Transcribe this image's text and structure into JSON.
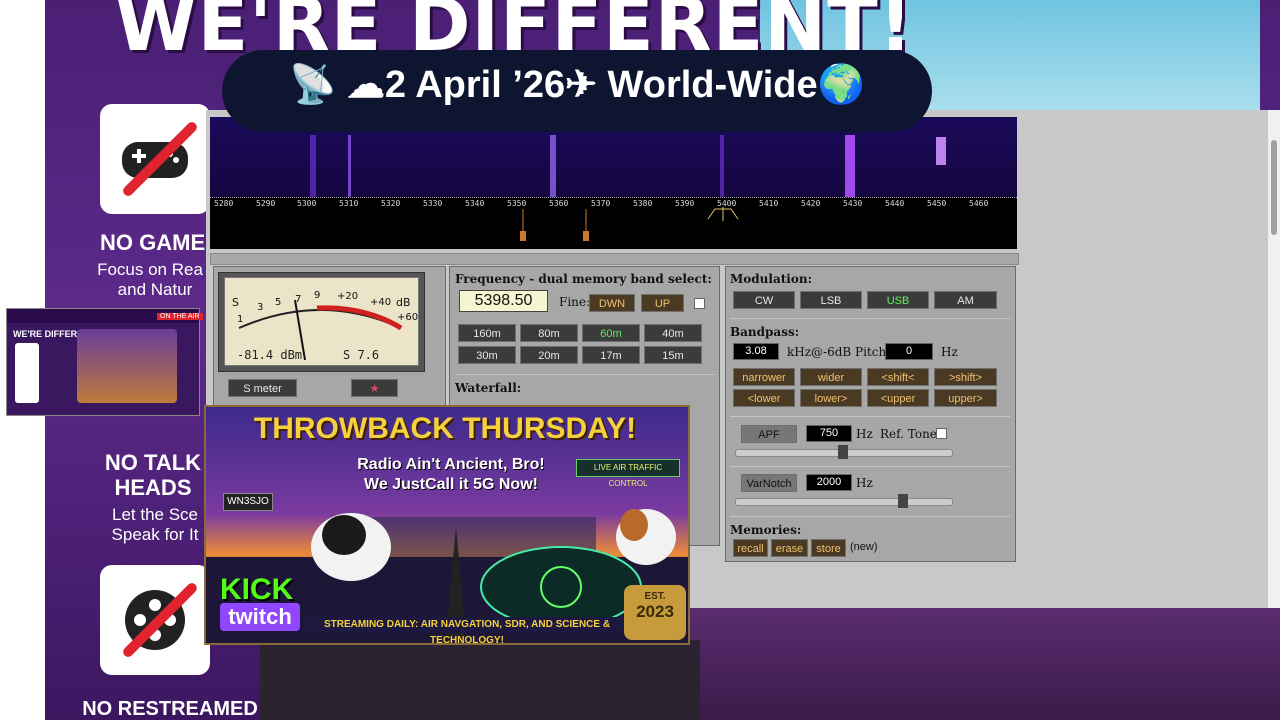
{
  "stream_background": {
    "headline": "WE'RE DIFFERENT!",
    "cards": [
      {
        "title": "NO GAMES",
        "subtitle_line1": "Focus on Rea",
        "subtitle_line2": "and Natur",
        "icon": "gamepad-icon"
      },
      {
        "title_line1": "NO TALK",
        "title_line2": "HEADS",
        "subtitle_line1": "Let the Sce",
        "subtitle_line2": "Speak for It",
        "icon": "microphone-icon"
      },
      {
        "title": "NO RESTREAMED",
        "icon": "film-reel-icon"
      }
    ]
  },
  "title_banner": {
    "text": "📡 ☁2 April ’26✈ World-Wide🌍"
  },
  "waterfall": {
    "frequency_ticks": [
      "5280",
      "5290",
      "5300",
      "5310",
      "5320",
      "5330",
      "5340",
      "5350",
      "5360",
      "5370",
      "5380",
      "5390",
      "5400",
      "5410",
      "5420",
      "5430",
      "5440",
      "5450",
      "5460"
    ]
  },
  "s_meter": {
    "scale": [
      "S",
      "1",
      "3",
      "5",
      "7",
      "9",
      "+20",
      "+40",
      "dB",
      "+60"
    ],
    "dbm": "-81.4 dBm",
    "s_value": "S 7.6",
    "level": 0.56,
    "button_label": "S meter"
  },
  "frequency": {
    "title": "Frequency - dual memory band select:",
    "value": "5398.50",
    "fine_label": "Fine:",
    "down_label": "DWN",
    "up_label": "UP",
    "bands": [
      "160m",
      "80m",
      "60m",
      "40m",
      "30m",
      "20m",
      "17m",
      "15m"
    ],
    "selected_band": "60m"
  },
  "waterfall_panel": {
    "title": "Waterfall:"
  },
  "modulation": {
    "title": "Modulation:",
    "modes": [
      "CW",
      "LSB",
      "USB",
      "AM"
    ],
    "selected": "USB"
  },
  "bandpass": {
    "title": "Bandpass:",
    "width_value": "3.08",
    "width_unit": "kHz@-6dB",
    "pitch_label": "Pitch:",
    "pitch_value": "0",
    "pitch_unit": "Hz",
    "buttons_row1": [
      "narrower",
      "wider",
      "<shift<",
      ">shift>"
    ],
    "buttons_row2": [
      "<lower",
      "lower>",
      "<upper",
      "upper>"
    ]
  },
  "apf": {
    "label": "APF",
    "value": "750",
    "unit": "Hz",
    "ref_tone_label": "Ref. Tone",
    "slider_level": 0.5
  },
  "varnotch": {
    "label": "VarNotch",
    "value": "2000",
    "unit": "Hz",
    "slider_level": 0.78
  },
  "memories": {
    "title": "Memories:",
    "recall": "recall",
    "erase": "erase",
    "store": "store",
    "status": "(new)"
  },
  "mini_preview": {
    "headline": "WE'RE DIFFERENT!",
    "badge": "ON THE AIR"
  },
  "throwback": {
    "title": "THROWBACK THURSDAY!",
    "line1": "Radio Ain't Ancient, Bro!",
    "line2": "We JustCall it 5G Now!",
    "callsign": "WN3SJO",
    "atc_label": "LIVE AIR TRAFFIC CONTROL",
    "kick": "KICK",
    "twitch": "twitch",
    "bottom_banner": "STREAMING DAILY: AIR NAVGATION, SDR, AND SCIENCE & TECHNOLOGY!",
    "est_label": "EST.",
    "est_year": "2023"
  },
  "colors": {
    "selected_green": "#5cf05c",
    "panel_gray": "#a7a7a7",
    "button_dark": "#3b3b3b"
  }
}
